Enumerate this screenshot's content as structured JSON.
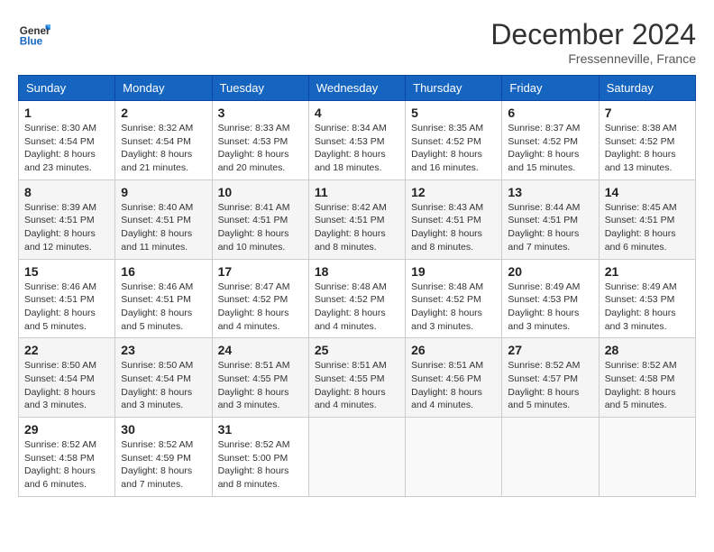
{
  "header": {
    "logo_general": "General",
    "logo_blue": "Blue",
    "month_title": "December 2024",
    "location": "Fressenneville, France"
  },
  "days_of_week": [
    "Sunday",
    "Monday",
    "Tuesday",
    "Wednesday",
    "Thursday",
    "Friday",
    "Saturday"
  ],
  "weeks": [
    [
      {
        "day": "1",
        "sunrise": "8:30 AM",
        "sunset": "4:54 PM",
        "daylight": "8 hours and 23 minutes."
      },
      {
        "day": "2",
        "sunrise": "8:32 AM",
        "sunset": "4:54 PM",
        "daylight": "8 hours and 21 minutes."
      },
      {
        "day": "3",
        "sunrise": "8:33 AM",
        "sunset": "4:53 PM",
        "daylight": "8 hours and 20 minutes."
      },
      {
        "day": "4",
        "sunrise": "8:34 AM",
        "sunset": "4:53 PM",
        "daylight": "8 hours and 18 minutes."
      },
      {
        "day": "5",
        "sunrise": "8:35 AM",
        "sunset": "4:52 PM",
        "daylight": "8 hours and 16 minutes."
      },
      {
        "day": "6",
        "sunrise": "8:37 AM",
        "sunset": "4:52 PM",
        "daylight": "8 hours and 15 minutes."
      },
      {
        "day": "7",
        "sunrise": "8:38 AM",
        "sunset": "4:52 PM",
        "daylight": "8 hours and 13 minutes."
      }
    ],
    [
      {
        "day": "8",
        "sunrise": "8:39 AM",
        "sunset": "4:51 PM",
        "daylight": "8 hours and 12 minutes."
      },
      {
        "day": "9",
        "sunrise": "8:40 AM",
        "sunset": "4:51 PM",
        "daylight": "8 hours and 11 minutes."
      },
      {
        "day": "10",
        "sunrise": "8:41 AM",
        "sunset": "4:51 PM",
        "daylight": "8 hours and 10 minutes."
      },
      {
        "day": "11",
        "sunrise": "8:42 AM",
        "sunset": "4:51 PM",
        "daylight": "8 hours and 8 minutes."
      },
      {
        "day": "12",
        "sunrise": "8:43 AM",
        "sunset": "4:51 PM",
        "daylight": "8 hours and 8 minutes."
      },
      {
        "day": "13",
        "sunrise": "8:44 AM",
        "sunset": "4:51 PM",
        "daylight": "8 hours and 7 minutes."
      },
      {
        "day": "14",
        "sunrise": "8:45 AM",
        "sunset": "4:51 PM",
        "daylight": "8 hours and 6 minutes."
      }
    ],
    [
      {
        "day": "15",
        "sunrise": "8:46 AM",
        "sunset": "4:51 PM",
        "daylight": "8 hours and 5 minutes."
      },
      {
        "day": "16",
        "sunrise": "8:46 AM",
        "sunset": "4:51 PM",
        "daylight": "8 hours and 5 minutes."
      },
      {
        "day": "17",
        "sunrise": "8:47 AM",
        "sunset": "4:52 PM",
        "daylight": "8 hours and 4 minutes."
      },
      {
        "day": "18",
        "sunrise": "8:48 AM",
        "sunset": "4:52 PM",
        "daylight": "8 hours and 4 minutes."
      },
      {
        "day": "19",
        "sunrise": "8:48 AM",
        "sunset": "4:52 PM",
        "daylight": "8 hours and 3 minutes."
      },
      {
        "day": "20",
        "sunrise": "8:49 AM",
        "sunset": "4:53 PM",
        "daylight": "8 hours and 3 minutes."
      },
      {
        "day": "21",
        "sunrise": "8:49 AM",
        "sunset": "4:53 PM",
        "daylight": "8 hours and 3 minutes."
      }
    ],
    [
      {
        "day": "22",
        "sunrise": "8:50 AM",
        "sunset": "4:54 PM",
        "daylight": "8 hours and 3 minutes."
      },
      {
        "day": "23",
        "sunrise": "8:50 AM",
        "sunset": "4:54 PM",
        "daylight": "8 hours and 3 minutes."
      },
      {
        "day": "24",
        "sunrise": "8:51 AM",
        "sunset": "4:55 PM",
        "daylight": "8 hours and 3 minutes."
      },
      {
        "day": "25",
        "sunrise": "8:51 AM",
        "sunset": "4:55 PM",
        "daylight": "8 hours and 4 minutes."
      },
      {
        "day": "26",
        "sunrise": "8:51 AM",
        "sunset": "4:56 PM",
        "daylight": "8 hours and 4 minutes."
      },
      {
        "day": "27",
        "sunrise": "8:52 AM",
        "sunset": "4:57 PM",
        "daylight": "8 hours and 5 minutes."
      },
      {
        "day": "28",
        "sunrise": "8:52 AM",
        "sunset": "4:58 PM",
        "daylight": "8 hours and 5 minutes."
      }
    ],
    [
      {
        "day": "29",
        "sunrise": "8:52 AM",
        "sunset": "4:58 PM",
        "daylight": "8 hours and 6 minutes."
      },
      {
        "day": "30",
        "sunrise": "8:52 AM",
        "sunset": "4:59 PM",
        "daylight": "8 hours and 7 minutes."
      },
      {
        "day": "31",
        "sunrise": "8:52 AM",
        "sunset": "5:00 PM",
        "daylight": "8 hours and 8 minutes."
      },
      null,
      null,
      null,
      null
    ]
  ],
  "labels": {
    "sunrise": "Sunrise:",
    "sunset": "Sunset:",
    "daylight": "Daylight:"
  }
}
